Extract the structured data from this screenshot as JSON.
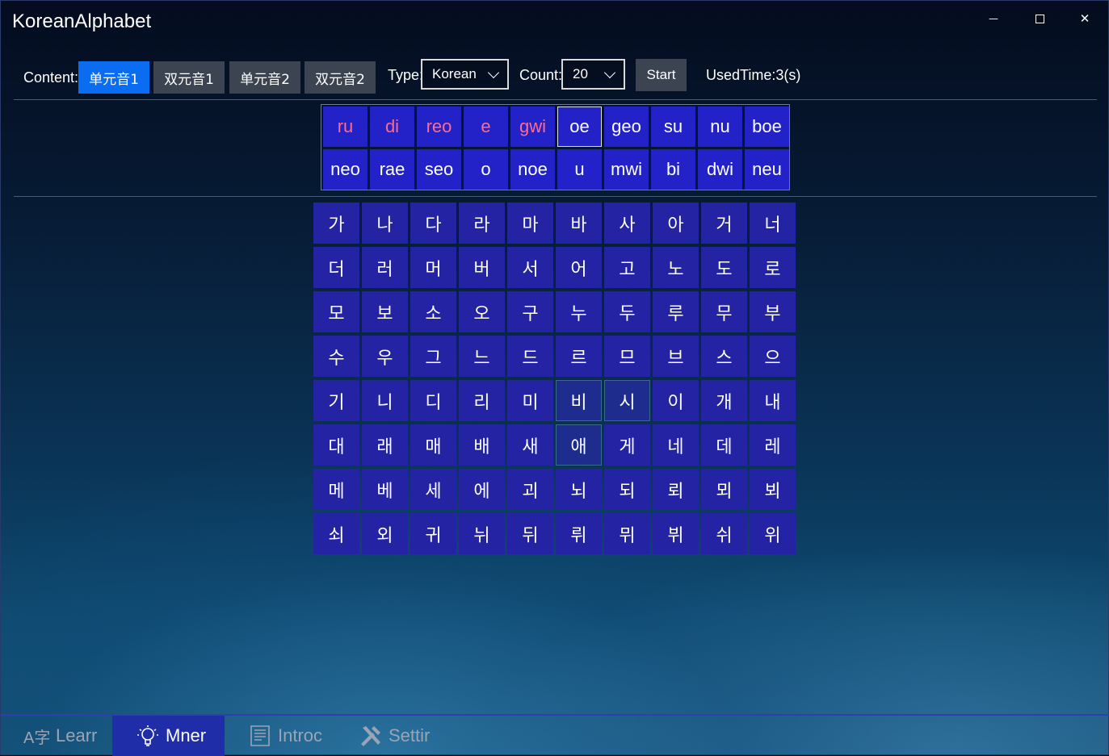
{
  "window": {
    "title": "KoreanAlphabet",
    "minimize_glyph": "—",
    "close_glyph": "✕"
  },
  "toolbar": {
    "content_label": "Content:",
    "content_options": [
      "单元音1",
      "双元音1",
      "单元音2",
      "双元音2"
    ],
    "content_selected_index": 0,
    "type_label": "Type:",
    "type_value": "Korean",
    "count_label": "Count:",
    "count_value": "20",
    "start_label": "Start",
    "used_time": "UsedTime:3(s)"
  },
  "romanization": {
    "row1": [
      "ru",
      "di",
      "reo",
      "e",
      "gwi",
      "oe",
      "geo",
      "su",
      "nu",
      "boe"
    ],
    "row2": [
      "neo",
      "rae",
      "seo",
      "o",
      "noe",
      "u",
      "mwi",
      "bi",
      "dwi",
      "neu"
    ],
    "answered_count": 5,
    "current_index": 5,
    "answered_color": "#ff6b8a"
  },
  "hangul": {
    "rows": [
      [
        "가",
        "나",
        "다",
        "라",
        "마",
        "바",
        "사",
        "아",
        "거",
        "너"
      ],
      [
        "더",
        "러",
        "머",
        "버",
        "서",
        "어",
        "고",
        "노",
        "도",
        "로"
      ],
      [
        "모",
        "보",
        "소",
        "오",
        "구",
        "누",
        "두",
        "루",
        "무",
        "부"
      ],
      [
        "수",
        "우",
        "그",
        "느",
        "드",
        "르",
        "므",
        "브",
        "스",
        "으"
      ],
      [
        "기",
        "니",
        "디",
        "리",
        "미",
        "비",
        "시",
        "이",
        "개",
        "내"
      ],
      [
        "대",
        "래",
        "매",
        "배",
        "새",
        "애",
        "게",
        "네",
        "데",
        "레"
      ],
      [
        "메",
        "베",
        "세",
        "에",
        "괴",
        "뇌",
        "되",
        "뢰",
        "뫼",
        "뵈"
      ],
      [
        "쇠",
        "외",
        "귀",
        "뉘",
        "뒤",
        "뤼",
        "뮈",
        "뷔",
        "쉬",
        "위"
      ]
    ],
    "cell_color": "#2323a3"
  },
  "bottom_nav": {
    "items": [
      {
        "label": "Learr",
        "icon": "translate-icon"
      },
      {
        "label": "Mner",
        "icon": "lightbulb-icon"
      },
      {
        "label": "Introc",
        "icon": "document-icon"
      },
      {
        "label": "Settir",
        "icon": "tools-icon"
      }
    ],
    "active_index": 1,
    "learn_icon_text": "A字"
  }
}
